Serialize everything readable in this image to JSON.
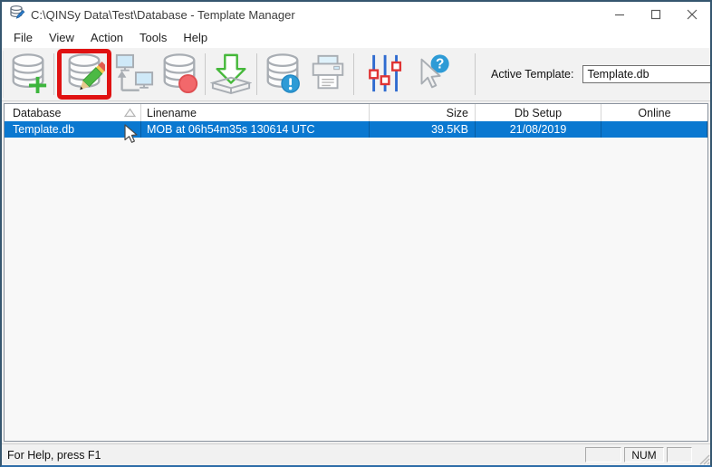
{
  "window": {
    "title": "C:\\QINSy Data\\Test\\Database - Template Manager",
    "controls": [
      "minimize",
      "maximize",
      "close"
    ]
  },
  "menu": {
    "items": [
      "File",
      "View",
      "Action",
      "Tools",
      "Help"
    ]
  },
  "toolbar": {
    "buttons": [
      {
        "icon": "database-add-icon"
      },
      {
        "icon": "database-edit-icon",
        "highlighted": true
      },
      {
        "icon": "replay-monitors-icon"
      },
      {
        "icon": "database-record-icon"
      },
      {
        "icon": "database-import-icon"
      },
      {
        "icon": "database-info-icon"
      },
      {
        "icon": "print-icon"
      },
      {
        "icon": "sliders-icon"
      },
      {
        "icon": "help-pointer-icon"
      }
    ],
    "active_template_label": "Active Template:",
    "active_template_value": "Template.db"
  },
  "table": {
    "columns": [
      {
        "label": "Database",
        "sorted_asc": true
      },
      {
        "label": "Linename"
      },
      {
        "label": "Size"
      },
      {
        "label": "Db Setup"
      },
      {
        "label": "Online"
      }
    ],
    "rows": [
      {
        "database": "Template.db",
        "linename": "MOB at 06h54m35s 130614 UTC",
        "size": "39.5KB",
        "db_setup": "21/08/2019",
        "online": ""
      }
    ]
  },
  "status_bar": {
    "help_text": "For Help, press F1",
    "panes": [
      "",
      "NUM",
      ""
    ]
  },
  "colors": {
    "selection_blue": "#0a78d0",
    "highlight_red": "#e01212",
    "window_border": "#35566f",
    "icon_blue": "#2e9bd6",
    "icon_green": "#45b83a",
    "icon_red": "#f2686b"
  }
}
